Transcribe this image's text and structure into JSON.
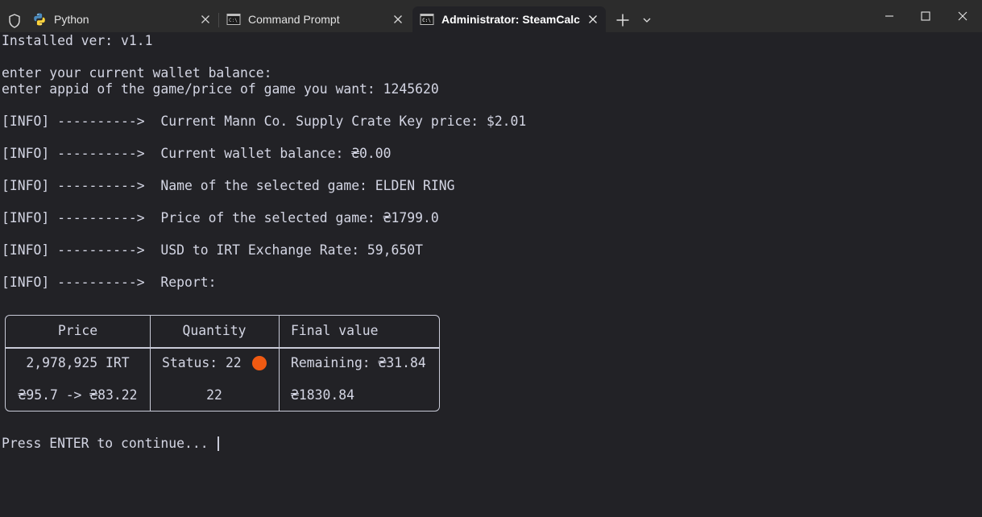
{
  "tabs": [
    {
      "label": "Python",
      "icon": "python-icon",
      "active": false
    },
    {
      "label": "Command Prompt",
      "icon": "cmd-icon",
      "active": false
    },
    {
      "label": "Administrator:  SteamCalc",
      "icon": "cmd-icon",
      "active": true
    }
  ],
  "terminal": {
    "installed": "Installed ver: v1.1",
    "prompt_wallet": "enter your current wallet balance:",
    "prompt_appid": "enter appid of the game/price of game you want: 1245620",
    "info_key_price": "[INFO] ---------->  Current Mann Co. Supply Crate Key price: $2.01",
    "info_wallet": "[INFO] ---------->  Current wallet balance: ₴0.00",
    "info_name": "[INFO] ---------->  Name of the selected game: ELDEN RING",
    "info_price": "[INFO] ---------->  Price of the selected game: ₴1799.0",
    "info_rate": "[INFO] ---------->  USD to IRT Exchange Rate: 59,650T",
    "info_report": "[INFO] ---------->  Report:",
    "continue": "Press ENTER to continue... "
  },
  "report": {
    "headers": {
      "price": "Price",
      "quantity": "Quantity",
      "final": "Final value"
    },
    "row1": {
      "price": "2,978,925 IRT",
      "quantity": "Status: 22",
      "final": "Remaining: ₴31.84"
    },
    "row2": {
      "price": "₴95.7 -> ₴83.22",
      "quantity": "22",
      "final": "₴1830.84"
    },
    "status_color": "#f05a12"
  },
  "colors": {
    "background": "#222226",
    "titlebar": "#2c2c2c",
    "text": "#d4d6e4"
  }
}
